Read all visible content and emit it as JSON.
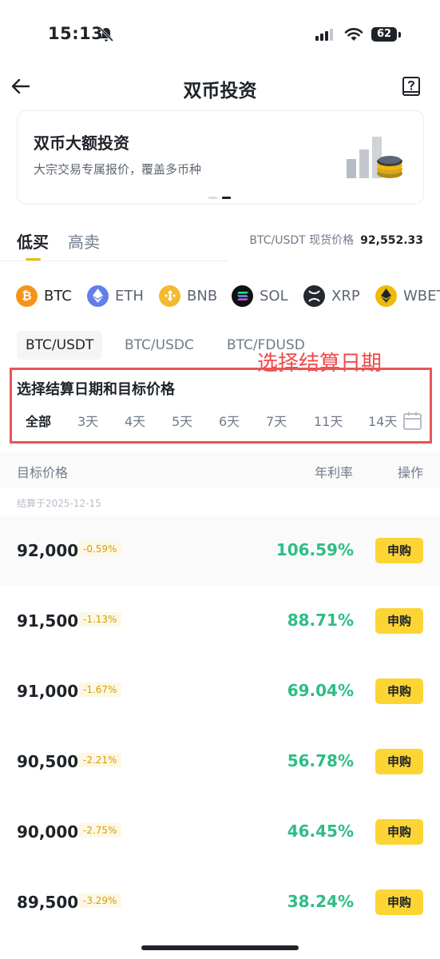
{
  "status_bar": {
    "time": "15:13",
    "battery": "62"
  },
  "header": {
    "title": "双币投资"
  },
  "banner": {
    "title": "双币大额投资",
    "subtitle": "大宗交易专属报价，覆盖多币种"
  },
  "direction_tabs": [
    {
      "label": "低买",
      "active": true
    },
    {
      "label": "高卖",
      "active": false
    }
  ],
  "spot_price": {
    "label": "BTC/USDT 现货价格",
    "value": "92,552.33"
  },
  "coins": [
    {
      "label": "BTC",
      "icon": "bitcoin-icon",
      "color": "#f7931a",
      "active": true
    },
    {
      "label": "ETH",
      "icon": "ethereum-icon",
      "color": "#627eea",
      "active": false
    },
    {
      "label": "BNB",
      "icon": "bnb-icon",
      "color": "#f3ba2f",
      "active": false
    },
    {
      "label": "SOL",
      "icon": "solana-icon",
      "color": "#111111",
      "active": false
    },
    {
      "label": "XRP",
      "icon": "xrp-icon",
      "color": "#23292f",
      "active": false
    },
    {
      "label": "WBET",
      "icon": "wbeth-icon",
      "color": "#f0b90b",
      "active": false
    }
  ],
  "pairs": [
    {
      "label": "BTC/USDT",
      "active": true
    },
    {
      "label": "BTC/USDC",
      "active": false
    },
    {
      "label": "BTC/FDUSD",
      "active": false
    }
  ],
  "annotation": {
    "label": "选择结算日期"
  },
  "settlement": {
    "title": "选择结算日期和目标价格",
    "days": [
      "全部",
      "3天",
      "4天",
      "5天",
      "6天",
      "7天",
      "11天",
      "14天"
    ]
  },
  "table": {
    "headers": {
      "target_price": "目标价格",
      "apr": "年利率",
      "action": "操作"
    },
    "settle_date": "结算于2025-12-15",
    "rows": [
      {
        "price": "92,000",
        "change": "-0.59%",
        "apr": "106.59%",
        "action": "申购"
      },
      {
        "price": "91,500",
        "change": "-1.13%",
        "apr": "88.71%",
        "action": "申购"
      },
      {
        "price": "91,000",
        "change": "-1.67%",
        "apr": "69.04%",
        "action": "申购"
      },
      {
        "price": "90,500",
        "change": "-2.21%",
        "apr": "56.78%",
        "action": "申购"
      },
      {
        "price": "90,000",
        "change": "-2.75%",
        "apr": "46.45%",
        "action": "申购"
      },
      {
        "price": "89,500",
        "change": "-3.29%",
        "apr": "38.24%",
        "action": "申购"
      }
    ]
  },
  "colors": {
    "accent": "#fcd535",
    "positive": "#2ebd85",
    "annotation": "#e85558"
  }
}
